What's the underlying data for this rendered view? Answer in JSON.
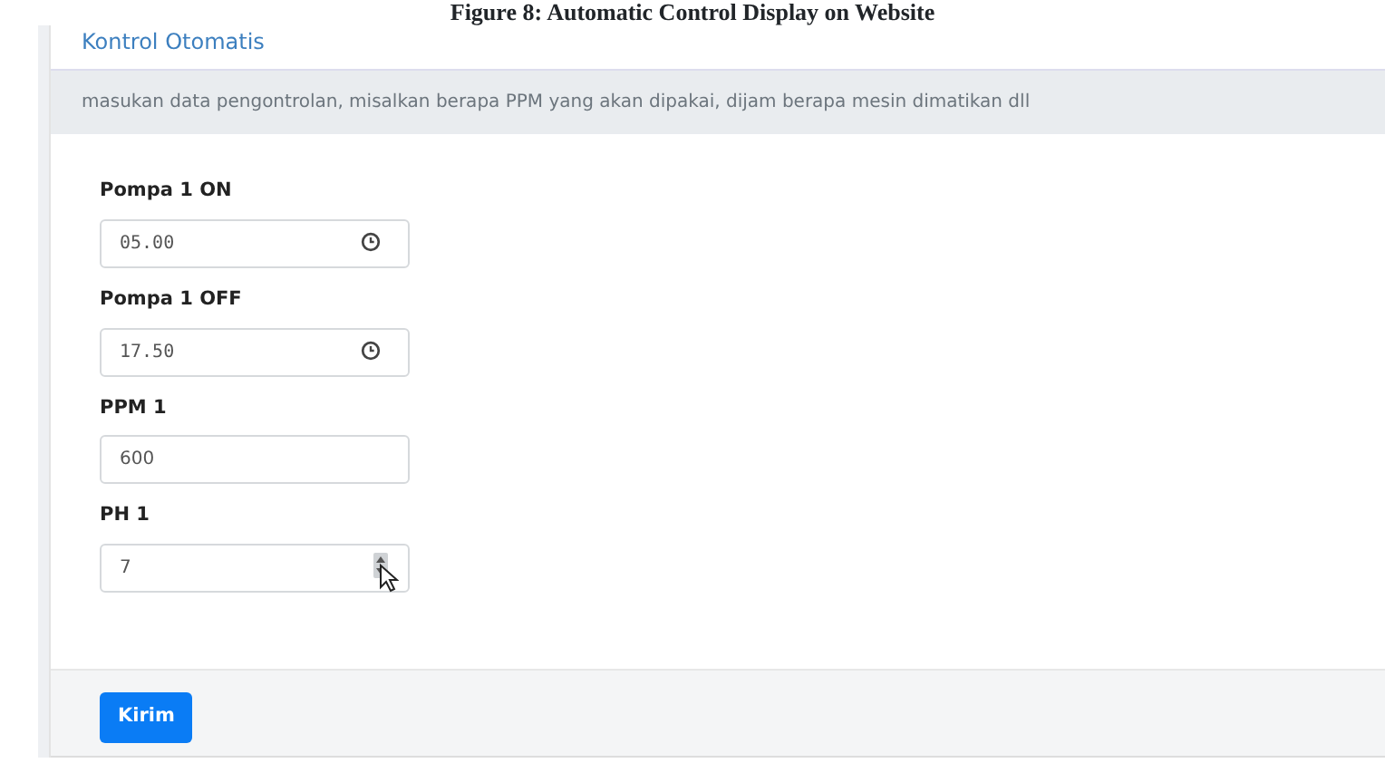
{
  "caption": "Figure 8: Automatic Control Display on Website",
  "card": {
    "title": "Kontrol Otomatis",
    "notice": "masukan data pengontrolan, misalkan berapa PPM yang akan dipakai, dijam berapa mesin dimatikan dll",
    "fields": [
      {
        "label": "Pompa 1 ON",
        "value": "05.00",
        "kind": "time"
      },
      {
        "label": "Pompa 1 OFF",
        "value": "17.50",
        "kind": "time"
      },
      {
        "label": "PPM 1",
        "value": "600",
        "kind": "text"
      },
      {
        "label": "PH 1",
        "value": "7",
        "kind": "number"
      }
    ],
    "submit": "Kirim"
  }
}
